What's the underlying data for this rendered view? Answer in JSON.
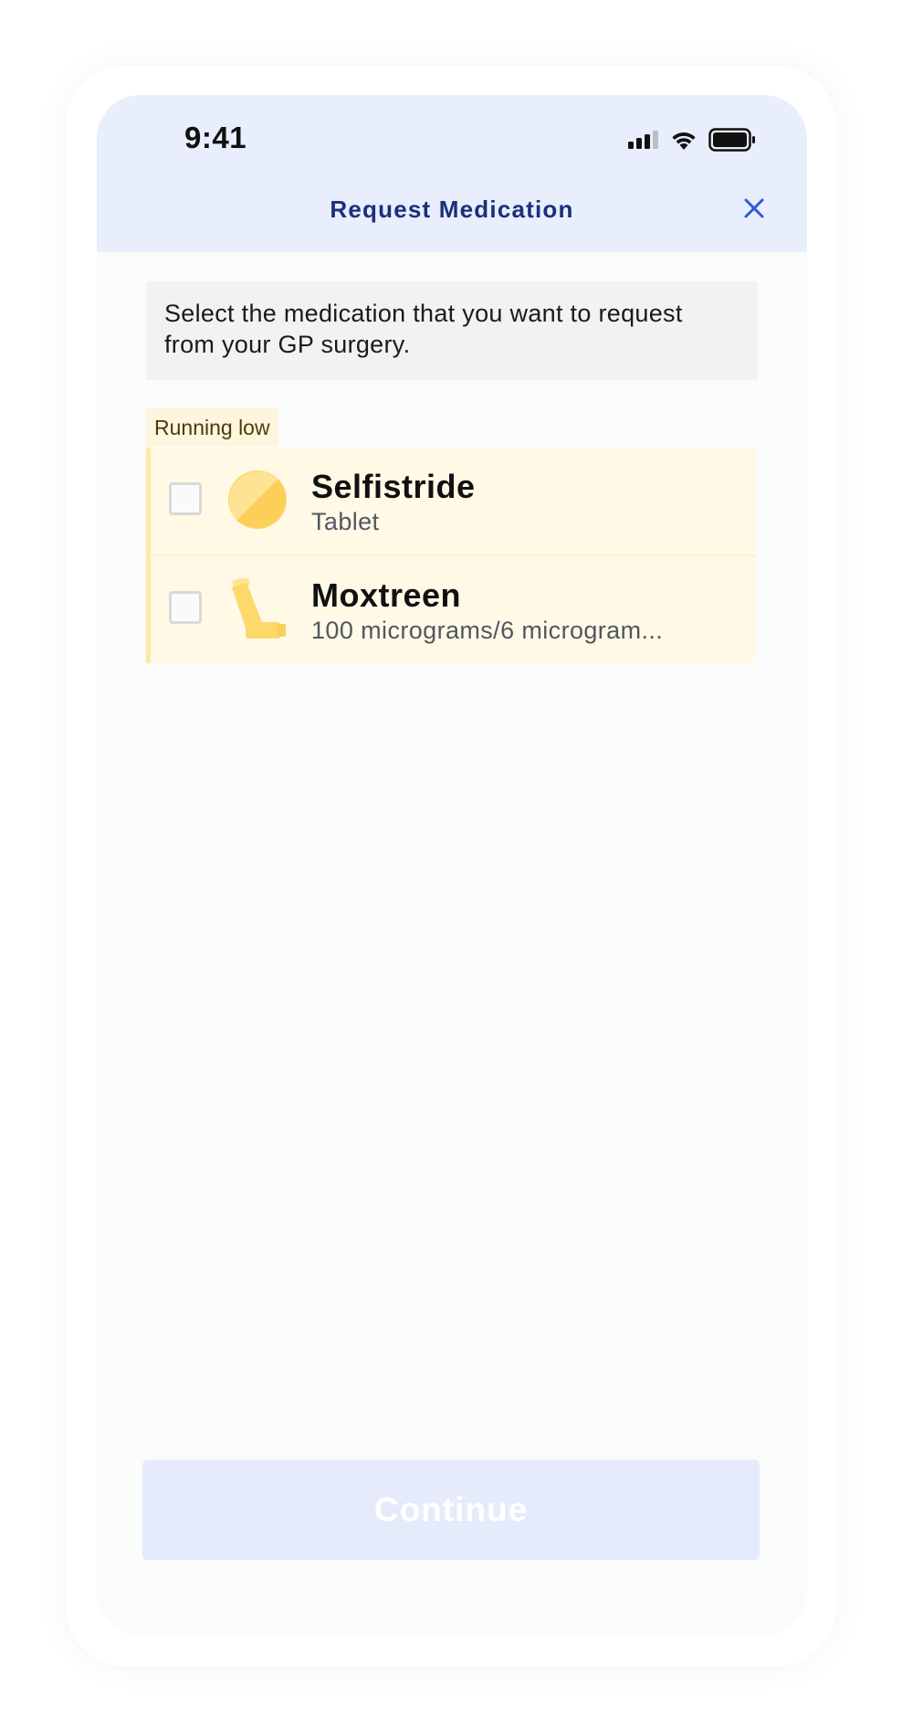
{
  "status_bar": {
    "time": "9:41",
    "icons": [
      "signal-icon",
      "wifi-icon",
      "battery-icon"
    ]
  },
  "header": {
    "title": "Request Medication",
    "close_icon": "close-icon"
  },
  "intro": {
    "text": "Select the medication that you want to request from your GP surgery."
  },
  "group": {
    "label": "Running low"
  },
  "medications": [
    {
      "name": "Selfistride",
      "description": "Tablet",
      "icon": "tablet-icon",
      "checked": false
    },
    {
      "name": "Moxtreen",
      "description": "100 micrograms/6 microgram...",
      "icon": "inhaler-icon",
      "checked": false
    }
  ],
  "footer": {
    "continue_label": "Continue",
    "continue_enabled": false
  },
  "colors": {
    "header_bg": "#e8eefc",
    "title": "#1b2f7a",
    "accent": "#2a5bd7",
    "running_low_bg": "#fff9e6",
    "running_low_border": "#fbe9a5",
    "med_icon": "#fdd86a",
    "button_disabled_bg": "#e6ebfb"
  }
}
